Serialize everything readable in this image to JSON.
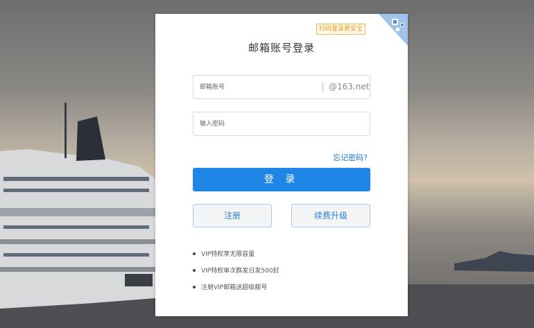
{
  "qr_badge": {
    "label": "扫码登录更安全"
  },
  "title": "邮箱账号登录",
  "account_field": {
    "placeholder": "邮箱账号",
    "value": "",
    "suffix": "@163.net"
  },
  "password_field": {
    "placeholder": "输入密码",
    "value": ""
  },
  "forgot_link": "忘记密码?",
  "login_button": "登 录",
  "register_button": "注册",
  "renew_button": "续费升级",
  "features": [
    "VIP特权享无限容量",
    "VIP特权单次群发日发500封",
    "注册VIP邮箱送超级靓号"
  ],
  "colors": {
    "primary": "#1f86e6",
    "link": "#1f73c9",
    "badge_border": "#f5b34b",
    "badge_text": "#f09a1a"
  }
}
